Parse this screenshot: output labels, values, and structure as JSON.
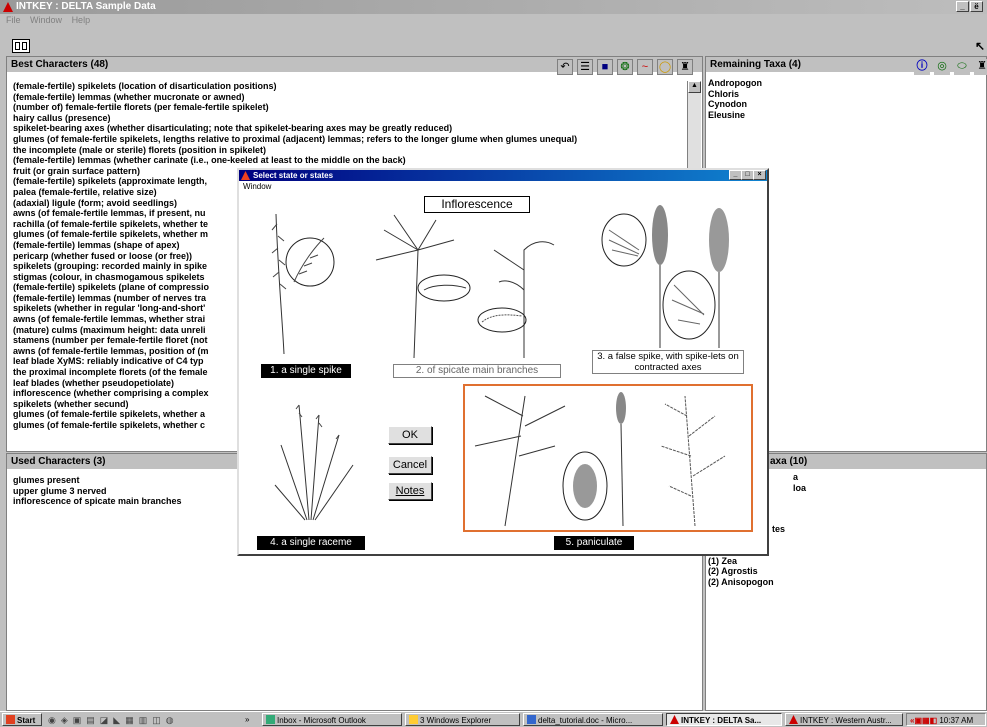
{
  "window": {
    "title": "INTKEY : DELTA Sample Data",
    "min": "_",
    "restore": "ё"
  },
  "menu": [
    "File",
    "Window",
    "Help"
  ],
  "best": {
    "title": "Best Characters (48)",
    "items": [
      "(female-fertile) spikelets (location of disarticulation positions)",
      "(female-fertile) lemmas (whether mucronate or awned)",
      "(number of) female-fertile florets (per female-fertile spikelet)",
      "hairy callus (presence)",
      "spikelet-bearing axes (whether disarticulating; note that spikelet-bearing axes may be greatly reduced)",
      "glumes (of female-fertile spikelets, lengths relative to proximal (adjacent) lemmas; refers to the longer glume when glumes unequal)",
      "the incomplete (male or sterile) florets (position in spikelet)",
      "(female-fertile) lemmas (whether carinate (i.e., one-keeled at least to the middle on the back)",
      "fruit (or grain surface pattern)",
      "(female-fertile) spikelets (approximate length,",
      "palea (female-fertile, relative size)",
      "(adaxial) ligule (form; avoid seedlings)",
      "awns (of female-fertile lemmas, if present, nu",
      "rachilla (of female-fertile spikelets, whether te",
      "glumes (of female-fertile spikelets, whether m",
      "(female-fertile) lemmas (shape of apex)",
      "pericarp (whether fused or loose (or free))",
      "spikelets (grouping: recorded mainly in spike",
      "stigmas (colour, in chasmogamous spikelets",
      "(female-fertile) spikelets (plane of compressio",
      "(female-fertile) lemmas (number of nerves tra",
      "spikelets (whether in regular 'long-and-short'",
      "awns (of female-fertile lemmas, whether strai",
      "(mature) culms (maximum height: data unreli",
      "stamens (number per female-fertile floret (not",
      "awns (of female-fertile lemmas, position of (m",
      "leaf blade XyMS: reliably indicative of C4 typ",
      "the proximal incomplete florets (of the female",
      "leaf blades (whether pseudopetiolate)",
      "inflorescence (whether comprising a complex",
      "spikelets (whether secund)",
      "glumes (of female-fertile spikelets, whether a",
      "glumes (of female-fertile spikelets, whether c"
    ]
  },
  "used": {
    "title": "Used Characters (3)",
    "items": [
      "glumes present",
      "upper glume 3 nerved",
      "inflorescence of spicate main branches"
    ]
  },
  "remaining": {
    "title": "Remaining Taxa (4)",
    "items": [
      "Andropogon",
      "Chloris",
      "Cynodon",
      "Eleusine"
    ]
  },
  "eliminated": {
    "title_fragment": "axa (10)",
    "fragments": [
      "a",
      "loa",
      "",
      "",
      "",
      "tes"
    ],
    "items": [
      "(1) Zea",
      "(2) Agrostis",
      "(2) Anisopogon"
    ]
  },
  "dialog": {
    "title": "Select state or states",
    "menu": "Window",
    "heading": "Inflorescence",
    "states": [
      "1. a single spike",
      "2. of spicate main branches",
      "3. a false spike, with spike-lets on contracted axes",
      "4. a single raceme",
      "5. paniculate"
    ],
    "buttons": {
      "ok": "OK",
      "cancel": "Cancel",
      "notes": "Notes"
    },
    "selected_state": 5
  },
  "taskbar": {
    "start": "Start",
    "items": [
      "Inbox - Microsoft Outlook",
      "3 Windows Explorer",
      "delta_tutorial.doc - Micro...",
      "INTKEY : DELTA Sa...",
      "INTKEY : Western Austr..."
    ],
    "more": "»",
    "time": "10:37 AM"
  },
  "icons": {
    "accent": "#000080",
    "selected_border": "#e07030"
  }
}
